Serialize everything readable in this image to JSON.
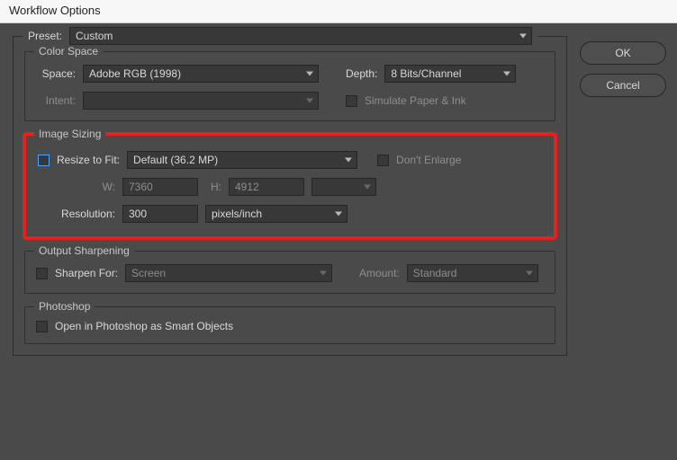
{
  "window": {
    "title": "Workflow Options"
  },
  "buttons": {
    "ok": "OK",
    "cancel": "Cancel"
  },
  "preset": {
    "label": "Preset:",
    "value": "Custom"
  },
  "color_space": {
    "legend": "Color Space",
    "space_label": "Space:",
    "space_value": "Adobe RGB (1998)",
    "depth_label": "Depth:",
    "depth_value": "8 Bits/Channel",
    "intent_label": "Intent:",
    "intent_value": "",
    "simulate_label": "Simulate Paper & Ink"
  },
  "image_sizing": {
    "legend": "Image Sizing",
    "resize_label": "Resize to Fit:",
    "resize_value": "Default  (36.2 MP)",
    "dont_enlarge": "Don't Enlarge",
    "w_label": "W:",
    "w_value": "7360",
    "h_label": "H:",
    "h_value": "4912",
    "unit_value": "",
    "res_label": "Resolution:",
    "res_value": "300",
    "res_unit": "pixels/inch"
  },
  "sharpening": {
    "legend": "Output Sharpening",
    "sharpen_label": "Sharpen For:",
    "sharpen_value": "Screen",
    "amount_label": "Amount:",
    "amount_value": "Standard"
  },
  "photoshop": {
    "legend": "Photoshop",
    "smart_objects": "Open in Photoshop as Smart Objects"
  }
}
